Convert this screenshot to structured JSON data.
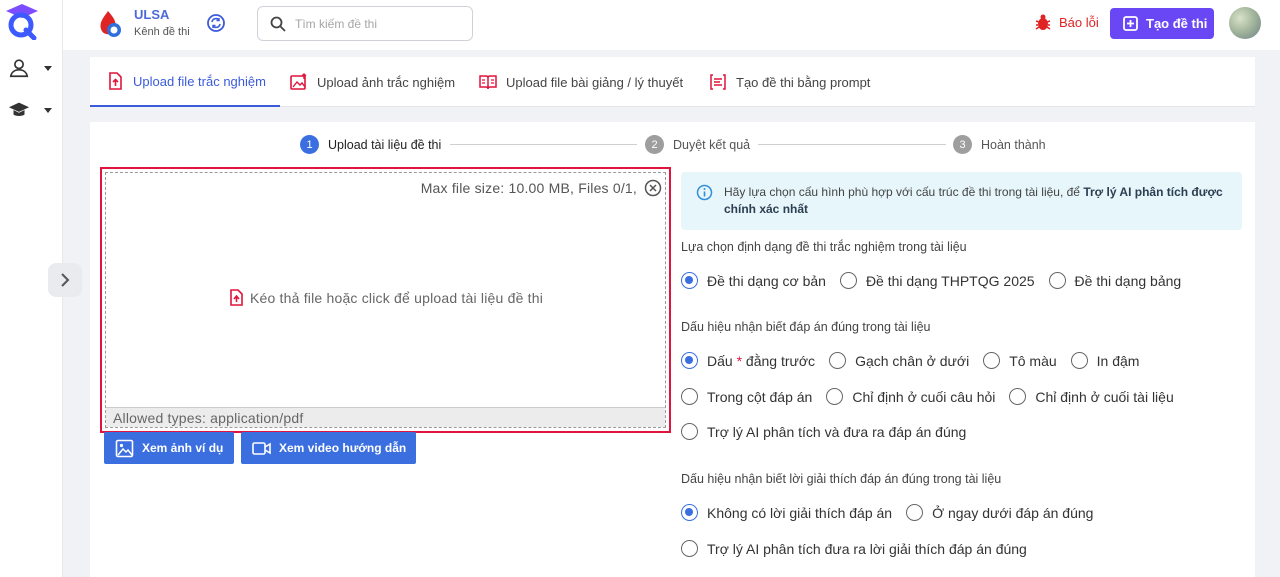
{
  "header": {
    "brand_name": "ULSA",
    "brand_sub": "Kênh đề thi",
    "search_placeholder": "Tìm kiếm đề thi",
    "report_label": "Báo lỗi",
    "create_label": "Tạo đề thi"
  },
  "tabs": [
    {
      "label": "Upload file trắc nghiệm",
      "icon": "file-upload-icon",
      "active": true
    },
    {
      "label": "Upload ảnh trắc nghiệm",
      "icon": "image-upload-icon",
      "active": false
    },
    {
      "label": "Upload file bài giảng / lý thuyết",
      "icon": "book-icon",
      "active": false
    },
    {
      "label": "Tạo đề thi bằng prompt",
      "icon": "prompt-icon",
      "active": false
    }
  ],
  "stepper": [
    {
      "num": "1",
      "label": "Upload tài liệu đề thi",
      "active": true
    },
    {
      "num": "2",
      "label": "Duyệt kết quả",
      "active": false
    },
    {
      "num": "3",
      "label": "Hoàn thành",
      "active": false
    }
  ],
  "dropzone": {
    "meta": "Max file size: 10.00 MB, Files 0/1,",
    "message": "Kéo thả file hoặc click để upload tài liệu đề thi",
    "allowed": "Allowed types: application/pdf"
  },
  "buttons": {
    "example_images": "Xem ảnh ví dụ",
    "video_guide": "Xem video hướng dẫn"
  },
  "info": {
    "text": "Hãy lựa chọn cấu hình phù hợp với cấu trúc đề thi trong tài liệu, để ",
    "bold": "Trợ lý AI phân tích được chính xác nhất"
  },
  "format_section": {
    "title": "Lựa chọn định dạng đề thi trắc nghiệm trong tài liệu",
    "options": [
      "Đề thi dạng cơ bản",
      "Đề thi dạng THPTQG 2025",
      "Đề thi dạng bảng"
    ],
    "selected": 0
  },
  "answer_section": {
    "title": "Dấu hiệu nhận biết đáp án đúng trong tài liệu",
    "opt_star_prefix": "Dấu",
    "opt_star_symbol": "*",
    "opt_star_suffix": "đằng trước",
    "row1": [
      "Gạch chân ở dưới",
      "Tô màu",
      "In đậm"
    ],
    "row2": [
      "Trong cột đáp án",
      "Chỉ định ở cuối câu hỏi",
      "Chỉ định ở cuối tài liệu"
    ],
    "row3": [
      "Trợ lý AI phân tích và đưa ra đáp án đúng"
    ]
  },
  "explain_section": {
    "title": "Dấu hiệu nhận biết lời giải thích đáp án đúng trong tài liệu",
    "row1": [
      "Không có lời giải thích đáp án",
      "Ở ngay dưới đáp án đúng"
    ],
    "row2": [
      "Trợ lý AI phân tích đưa ra lời giải thích đáp án đúng"
    ]
  },
  "colors": {
    "accent": "#3b6fe0",
    "create_button": "#6a47f5",
    "report": "#e02424",
    "highlight_border": "#e0143c"
  }
}
